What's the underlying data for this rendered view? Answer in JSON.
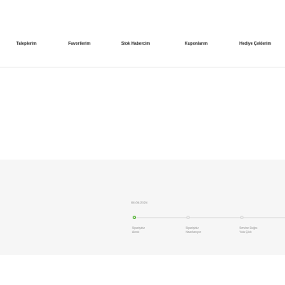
{
  "nav": {
    "items": [
      "Taleplerim",
      "Favorilerim",
      "Stok Habercim",
      "Kuponlarım",
      "Hediye Çeklerim"
    ]
  },
  "order": {
    "date": "06.06.2024",
    "steps": [
      {
        "line1": "Siparişiniz",
        "line2": "Alındı",
        "active": true
      },
      {
        "line1": "Siparişiniz",
        "line2": "Hazırlanıyor",
        "active": false
      },
      {
        "line1": "Servise Doğru",
        "line2": "Yola Çıktı",
        "active": false
      }
    ]
  },
  "colors": {
    "active_step": "#4caf2a",
    "inactive_step": "#d8d8d8",
    "section_bg": "#f6f6f6"
  }
}
